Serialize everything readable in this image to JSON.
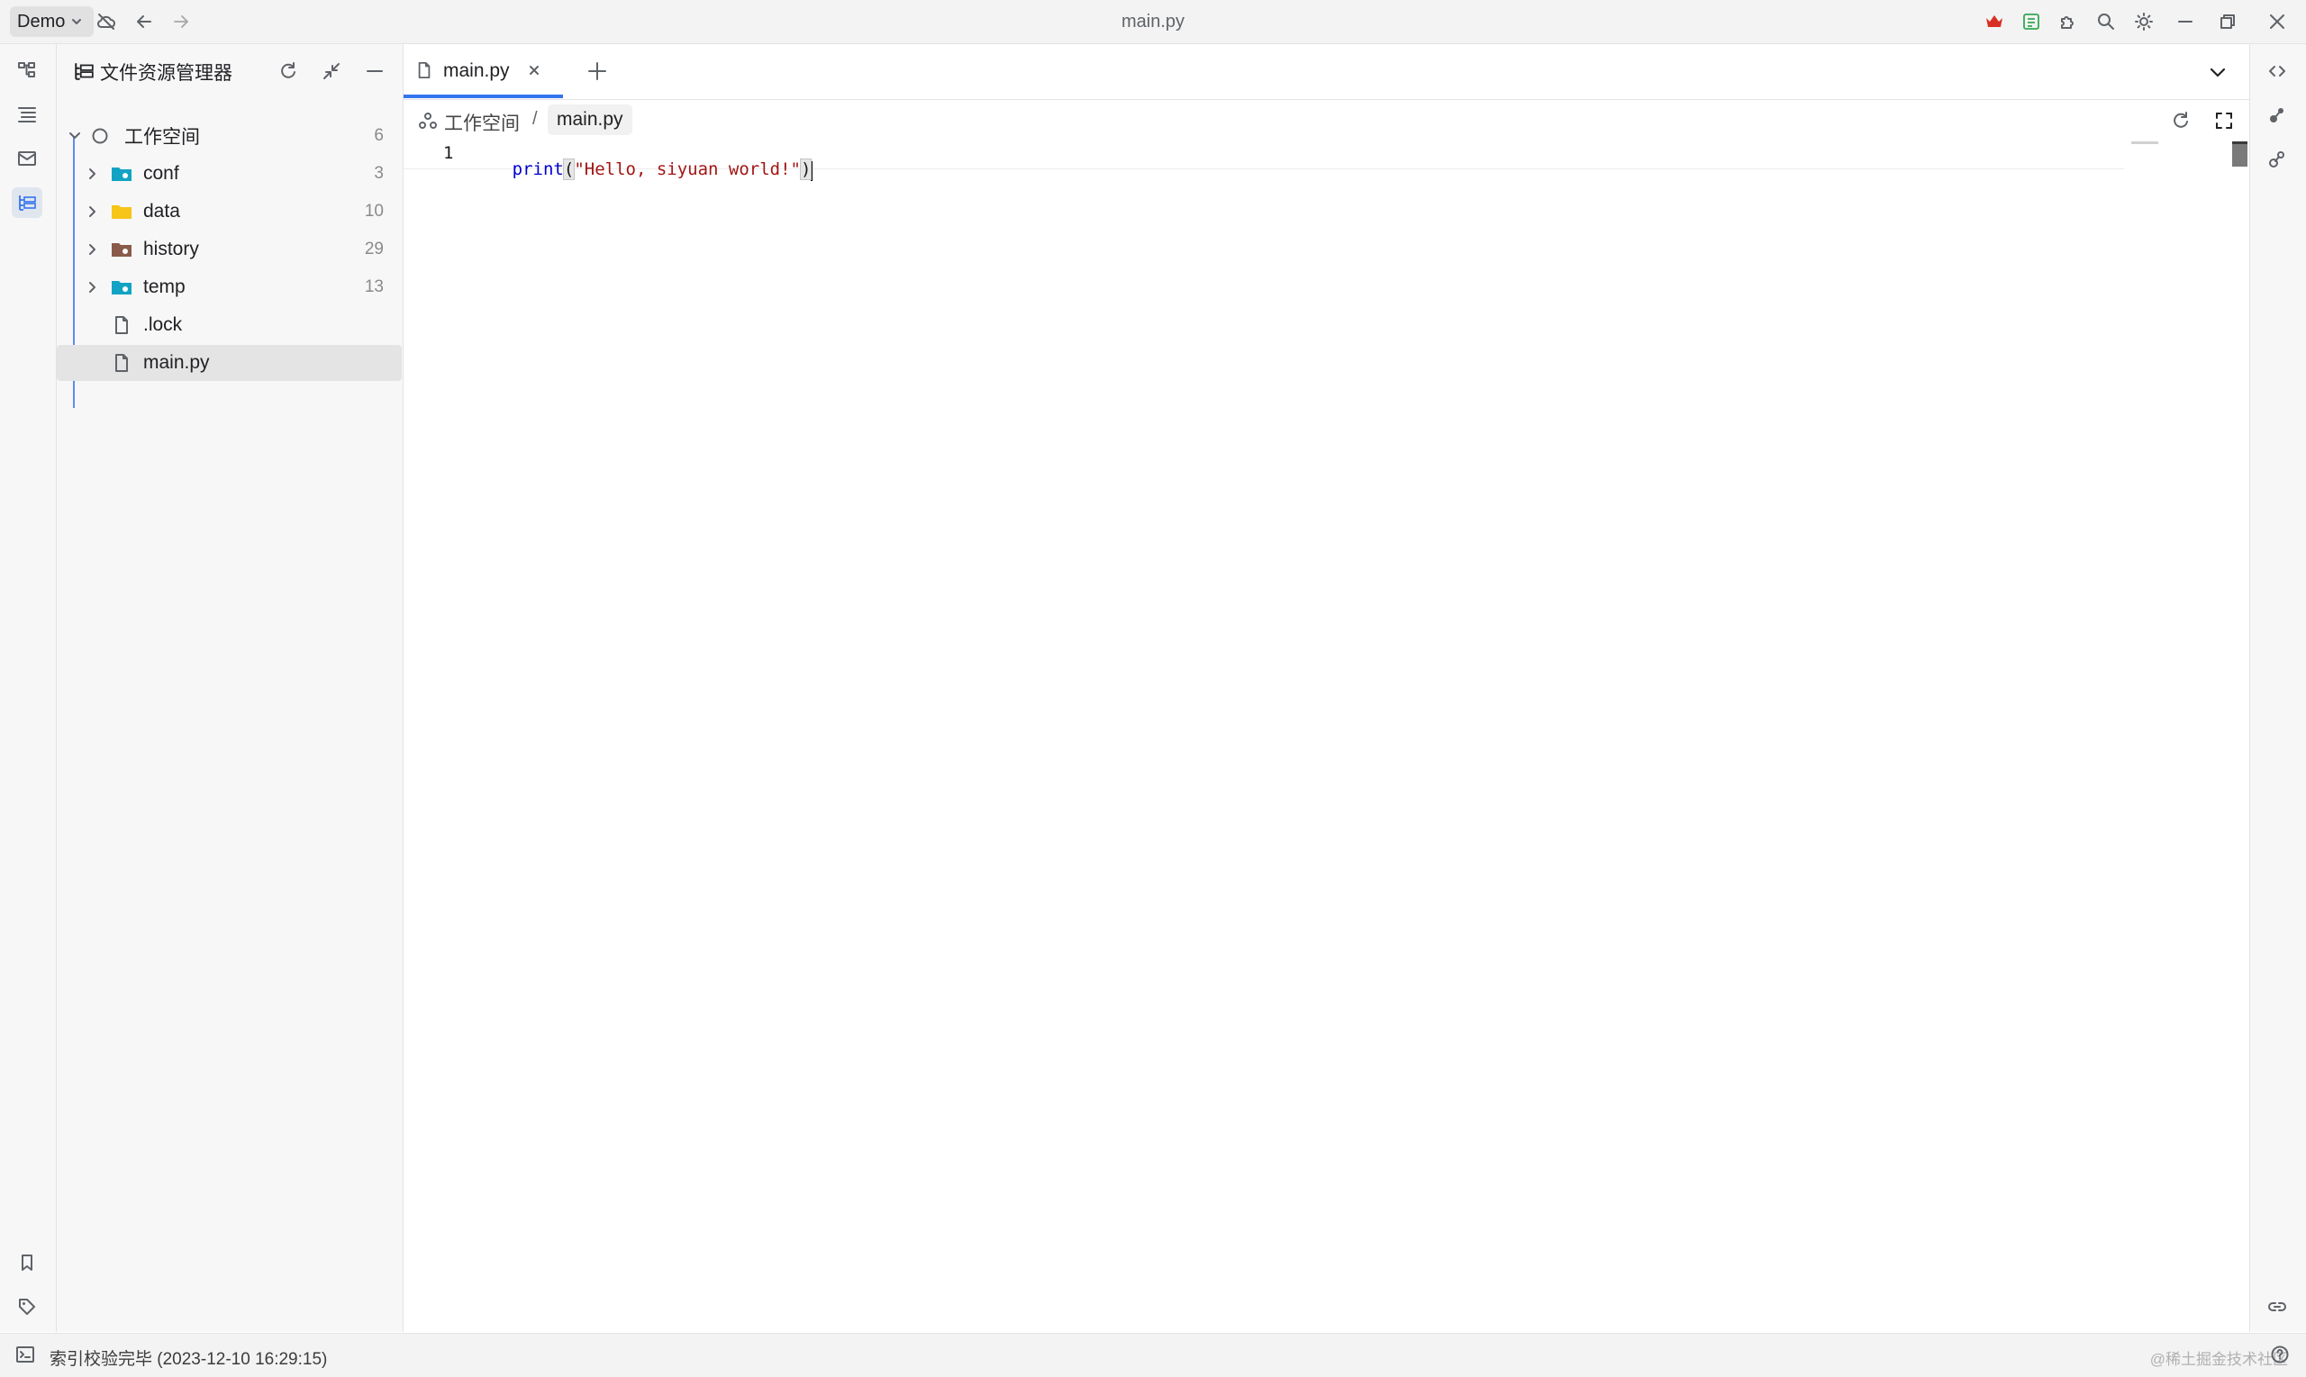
{
  "titlebar": {
    "workspace_name": "Demo",
    "window_title": "main.py"
  },
  "file_panel": {
    "title": "文件资源管理器",
    "root": {
      "label": "工作空间",
      "count": "6"
    },
    "items": [
      {
        "label": "conf",
        "count": "3",
        "type": "folder",
        "color": "#12a3c4"
      },
      {
        "label": "data",
        "count": "10",
        "type": "folder",
        "color": "#f5c518"
      },
      {
        "label": "history",
        "count": "29",
        "type": "folder",
        "color": "#8a5a4a"
      },
      {
        "label": "temp",
        "count": "13",
        "type": "folder",
        "color": "#12a3c4"
      },
      {
        "label": ".lock",
        "count": "",
        "type": "file"
      },
      {
        "label": "main.py",
        "count": "",
        "type": "file",
        "selected": true
      }
    ]
  },
  "editor": {
    "tab_label": "main.py",
    "breadcrumb_root": "工作空间",
    "breadcrumb_separator": "/",
    "breadcrumb_file": "main.py",
    "line_number": "1",
    "code_func": "print",
    "code_open": "(",
    "code_string": "\"Hello, siyuan world!\"",
    "code_close": ")"
  },
  "statusbar": {
    "message": "索引校验完毕 (2023-12-10 16:29:15)",
    "watermark": "@稀土掘金技术社区"
  },
  "colors": {
    "accent": "#3574f0",
    "code_keyword": "#0000cc",
    "code_string": "#a31515",
    "gift_red": "#d93025",
    "ext_green": "#34a853"
  },
  "icons": {
    "titlebar": [
      "cloud-off-icon",
      "back-arrow-icon",
      "forward-arrow-icon",
      "crown-icon",
      "plugin-market-icon",
      "puzzle-icon",
      "search-icon",
      "sun-icon",
      "minimize-icon",
      "restore-icon",
      "close-icon"
    ],
    "left_dock": [
      "structure-icon",
      "outline-icon",
      "inbox-icon",
      "file-tree-icon",
      "bookmark-icon",
      "tag-icon"
    ],
    "right_dock": [
      "code-icon",
      "graph-icon",
      "global-graph-icon",
      "backlink-icon",
      "help-icon"
    ]
  }
}
